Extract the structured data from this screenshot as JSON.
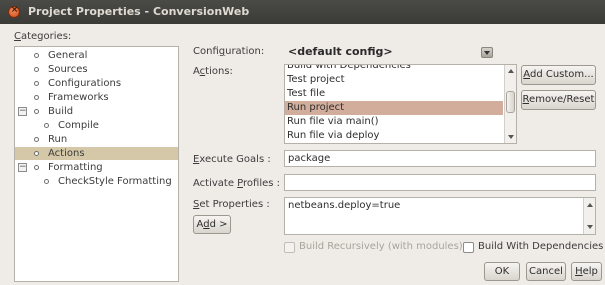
{
  "window": {
    "title": "Project Properties - ConversionWeb"
  },
  "categories": {
    "label_pre": "",
    "label_u": "C",
    "label_post": "ategories:",
    "items": [
      {
        "label": "General"
      },
      {
        "label": "Sources"
      },
      {
        "label": "Configurations"
      },
      {
        "label": "Frameworks"
      },
      {
        "label": "Build",
        "expander": "−"
      },
      {
        "label": "Compile"
      },
      {
        "label": "Run"
      },
      {
        "label": "Actions",
        "selected": true
      },
      {
        "label": "Formatting",
        "expander": "−"
      },
      {
        "label": "CheckStyle Formatting"
      }
    ]
  },
  "configuration": {
    "label_pre": "Confi",
    "label_u": "g",
    "label_post": "uration:",
    "value": "<default config>"
  },
  "actions": {
    "label_pre": "A",
    "label_u": "c",
    "label_post": "tions:",
    "items": [
      "Build with Dependencies",
      "Test project",
      "Test file",
      "Run project",
      "Run file via main()",
      "Run file via deploy"
    ],
    "selected": "Run project",
    "add_custom_pre": "",
    "add_custom_u": "A",
    "add_custom_post": "dd Custom...",
    "remove_reset_pre": "",
    "remove_reset_u": "R",
    "remove_reset_post": "emove/Reset"
  },
  "execute_goals": {
    "label_pre": "",
    "label_u": "E",
    "label_post": "xecute Goals :",
    "value": "package"
  },
  "activate_profiles": {
    "label_pre": "Activate ",
    "label_u": "P",
    "label_post": "rofiles :",
    "value": ""
  },
  "set_properties": {
    "label_pre": "",
    "label_u": "S",
    "label_post": "et Properties :",
    "value": "netbeans.deploy=true",
    "add_pre": "A",
    "add_u": "d",
    "add_post": "d >"
  },
  "options": {
    "build_recursively": "Build Recursively (with modules)",
    "build_with_dependencies": "Build With Dependencies"
  },
  "footer": {
    "ok": "OK",
    "cancel": "Cancel",
    "help_pre": "",
    "help_u": "H",
    "help_post": "elp"
  }
}
